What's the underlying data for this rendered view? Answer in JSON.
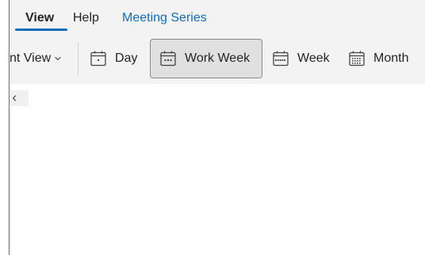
{
  "tabs": {
    "view": "View",
    "help": "Help",
    "meeting_series": "Meeting Series"
  },
  "ribbon": {
    "current_view_label": "nt View",
    "day_label": "Day",
    "work_week_label": "Work Week",
    "week_label": "Week",
    "month_label": "Month",
    "selected": "Work Week"
  },
  "icons": {
    "current_view_dropdown": "chevron-down-icon",
    "day": "calendar-day-icon",
    "work_week": "calendar-work-week-icon",
    "week": "calendar-week-icon",
    "month": "calendar-month-icon",
    "collapse": "chevron-left-icon"
  },
  "colors": {
    "accent": "#0f6cbd",
    "ribbon_bg": "#f3f3f3",
    "selected_bg": "#e0e0e0",
    "text": "#242424"
  }
}
